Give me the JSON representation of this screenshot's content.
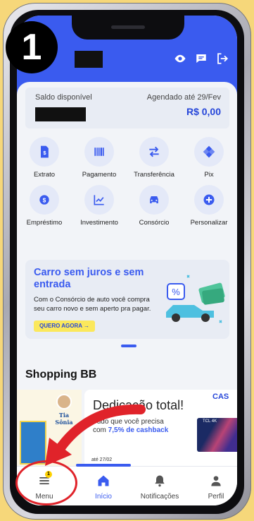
{
  "step_number": "1",
  "header": {
    "icons": [
      "eye-icon",
      "chat-icon",
      "logout-icon"
    ],
    "accent": "#3a5bef"
  },
  "balance": {
    "label": "Saldo disponível",
    "scheduled_label": "Agendado até 29/Fev",
    "scheduled_value": "R$ 0,00"
  },
  "shortcuts": [
    {
      "label": "Extrato",
      "icon": "statement-icon"
    },
    {
      "label": "Pagamento",
      "icon": "barcode-icon"
    },
    {
      "label": "Transferência",
      "icon": "transfer-icon"
    },
    {
      "label": "Pix",
      "icon": "pix-icon"
    },
    {
      "label": "Empréstimo",
      "icon": "loan-icon"
    },
    {
      "label": "Investimento",
      "icon": "chart-icon"
    },
    {
      "label": "Consórcio",
      "icon": "car-icon"
    },
    {
      "label": "Personalizar",
      "icon": "plus-icon"
    }
  ],
  "promo": {
    "title": "Carro sem juros e sem entrada",
    "text": "Com o Consórcio de auto você compra seu carro novo e sem aperto pra pagar.",
    "button": "QUERO AGORA →"
  },
  "shopping": {
    "title": "Shopping BB",
    "left_card_brand": "Tia Sônia",
    "main_title": "Dedicação total!",
    "main_text_1": "Tudo que você precisa com ",
    "main_text_highlight": "7,5% de cashback",
    "date": "até 27/02",
    "next_card_label": "CAS",
    "tv_brand": "TCL 4K"
  },
  "tabs": [
    {
      "label": "Menu",
      "icon": "menu-icon",
      "badge": "1"
    },
    {
      "label": "Início",
      "icon": "home-icon"
    },
    {
      "label": "Notificações",
      "icon": "bell-icon"
    },
    {
      "label": "Perfil",
      "icon": "person-icon"
    }
  ],
  "active_tab": "Início"
}
